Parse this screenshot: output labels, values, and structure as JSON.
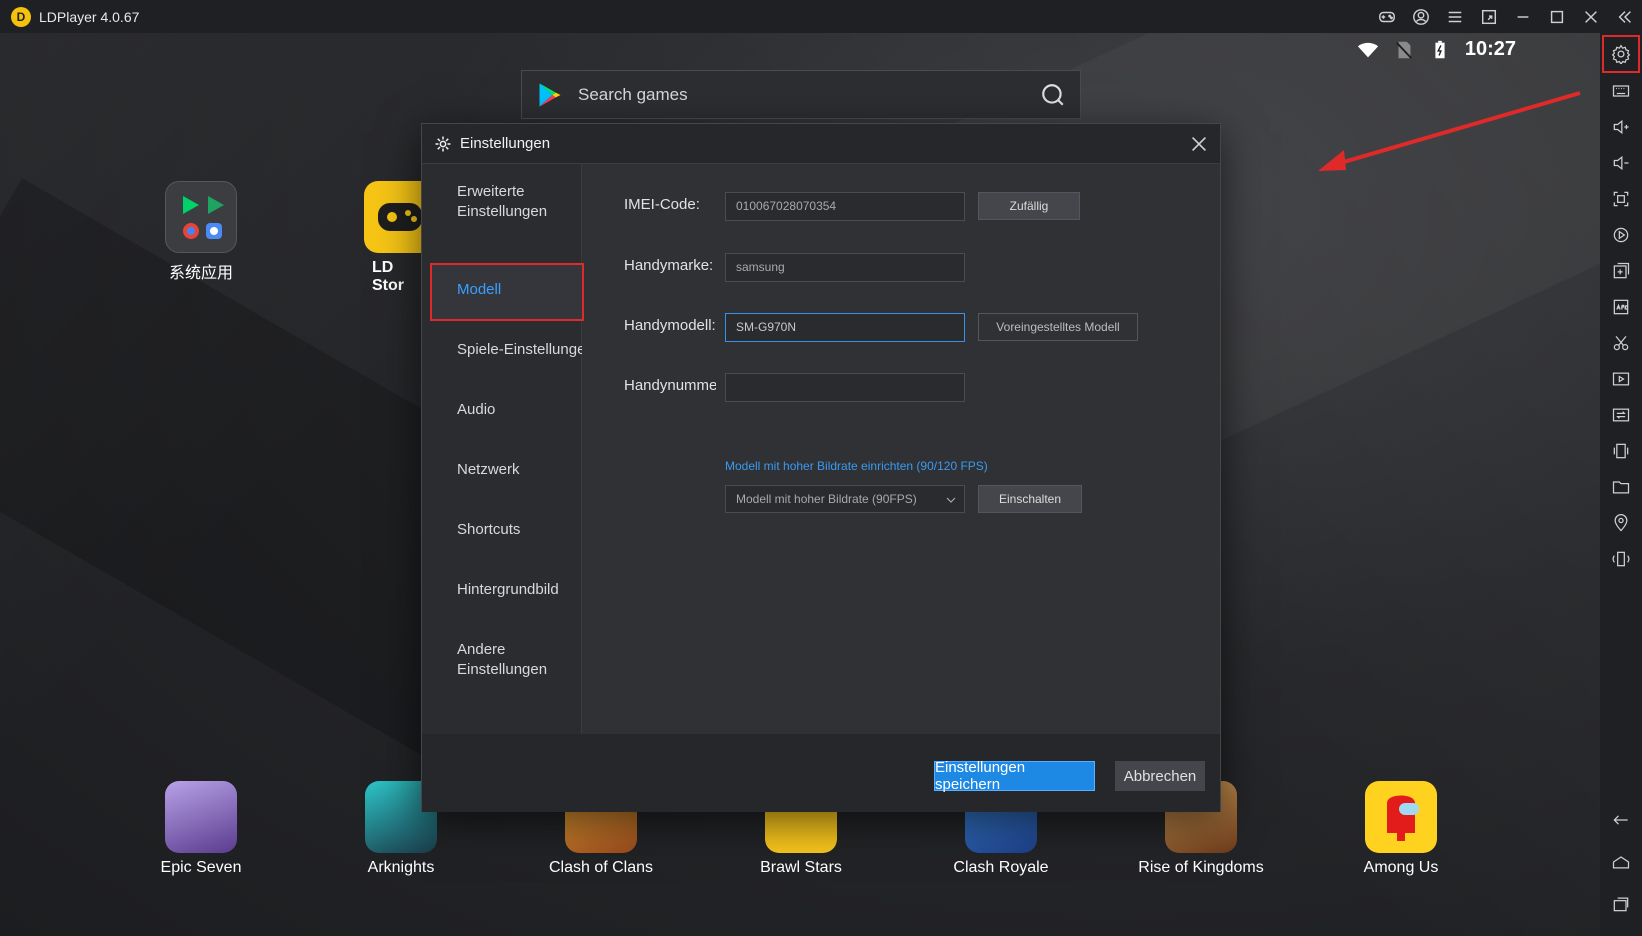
{
  "titlebar": {
    "app_name": "LDPlayer 4.0.67",
    "logo_letter": "D",
    "icons": [
      "gamepad-icon",
      "account-icon",
      "menu-icon",
      "pin-icon",
      "minimize-icon",
      "maximize-icon",
      "close-icon",
      "collapse-icon"
    ]
  },
  "status_bar": {
    "time": "10:27"
  },
  "search": {
    "placeholder": "Search games"
  },
  "desktop_apps": [
    {
      "label": "系统应用"
    },
    {
      "label": "LD Stor"
    }
  ],
  "dock_apps": [
    {
      "label": "Epic Seven"
    },
    {
      "label": "Arknights"
    },
    {
      "label": "Clash of Clans"
    },
    {
      "label": "Brawl Stars"
    },
    {
      "label": "Clash Royale"
    },
    {
      "label": "Rise of Kingdoms"
    },
    {
      "label": "Among Us"
    }
  ],
  "dialog": {
    "title": "Einstellungen",
    "nav": [
      {
        "label_line1": "Erweiterte",
        "label_line2": "Einstellungen"
      },
      {
        "label_line1": "Modell"
      },
      {
        "label_line1": "Spiele-Einstellungen"
      },
      {
        "label_line1": "Audio"
      },
      {
        "label_line1": "Netzwerk"
      },
      {
        "label_line1": "Shortcuts"
      },
      {
        "label_line1": "Hintergrundbild"
      },
      {
        "label_line1": "Andere",
        "label_line2": "Einstellungen"
      }
    ],
    "form": {
      "imei_label": "IMEI-Code:",
      "imei_value": "010067028070354",
      "random_button": "Zufällig",
      "brand_label": "Handymarke:",
      "brand_value": "samsung",
      "model_label": "Handymodell:",
      "model_value": "SM-G970N",
      "preset_button": "Voreingestelltes Modell",
      "number_label": "Handynummer:",
      "number_value": "",
      "high_fps_link": "Modell mit hoher Bildrate einrichten (90/120 FPS)",
      "high_fps_select": "Modell mit hoher Bildrate (90FPS)",
      "enable_button": "Einschalten"
    },
    "save_button": "Einstellungen speichern",
    "cancel_button": "Abbrechen"
  }
}
